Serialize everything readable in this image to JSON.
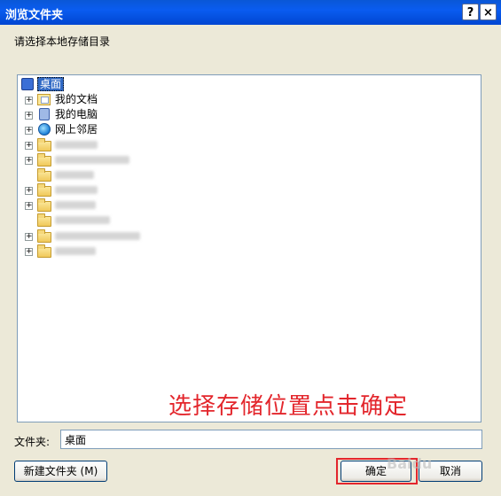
{
  "window": {
    "title": "浏览文件夹",
    "help_glyph": "?",
    "close_glyph": "×"
  },
  "instruction": "请选择本地存储目录",
  "tree": {
    "root": {
      "label": "桌面",
      "icon": "desktop-icon"
    },
    "items": [
      {
        "label": "我的文档",
        "icon": "my-documents-icon",
        "expandable": true
      },
      {
        "label": "我的电脑",
        "icon": "my-computer-icon",
        "expandable": true
      },
      {
        "label": "网上邻居",
        "icon": "network-icon",
        "expandable": true
      },
      {
        "label": "",
        "icon": "folder-icon",
        "expandable": true
      },
      {
        "label": "",
        "icon": "folder-icon",
        "expandable": true
      },
      {
        "label": "",
        "icon": "folder-icon",
        "expandable": false
      },
      {
        "label": "",
        "icon": "folder-icon",
        "expandable": true
      },
      {
        "label": "",
        "icon": "folder-icon",
        "expandable": true
      },
      {
        "label": "",
        "icon": "folder-icon",
        "expandable": false
      },
      {
        "label": "",
        "icon": "folder-icon",
        "expandable": true
      },
      {
        "label": "",
        "icon": "folder-icon",
        "expandable": true
      }
    ],
    "expand_glyph": "+"
  },
  "annotation": "选择存储位置点击确定",
  "folder_field": {
    "label": "文件夹:",
    "value": "桌面"
  },
  "buttons": {
    "new_folder": "新建文件夹 (M)",
    "ok": "确定",
    "cancel": "取消"
  },
  "watermark": "Baidu",
  "colors": {
    "titlebar": "#0a5cf0",
    "annotation": "#e3262c",
    "selection": "#316ac5"
  }
}
